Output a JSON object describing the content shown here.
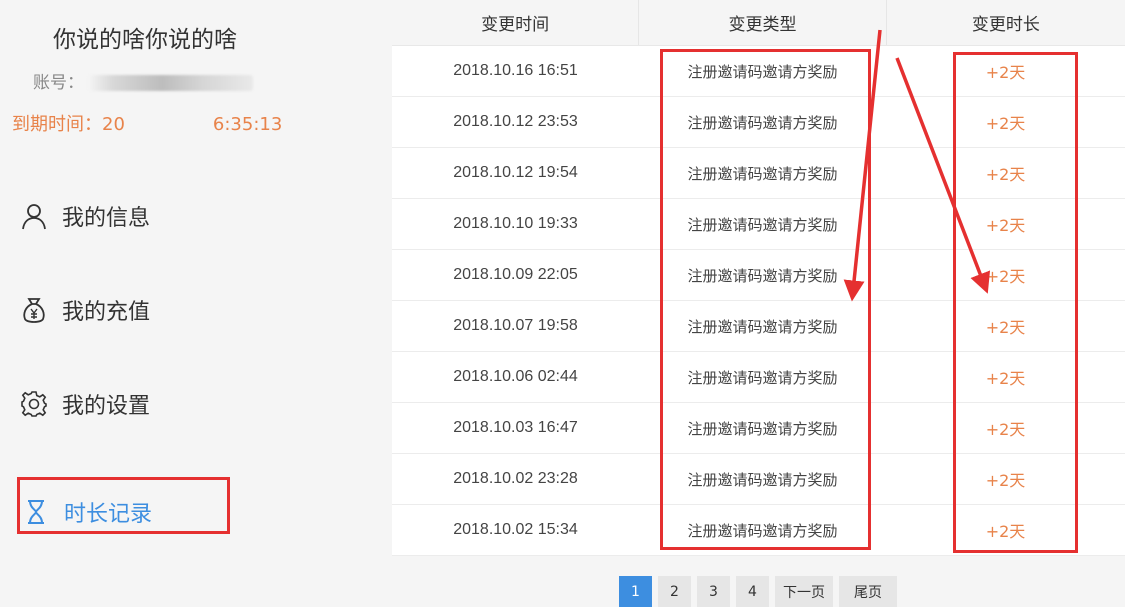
{
  "profile": {
    "username": "你说的啥你说的啥",
    "account_label": "账号：",
    "expire_label": "到期时间：",
    "expire_prefix": "20",
    "expire_suffix": "6:35:13"
  },
  "nav": {
    "items": [
      {
        "label": "我的信息",
        "icon": "user-icon"
      },
      {
        "label": "我的充值",
        "icon": "money-bag-icon"
      },
      {
        "label": "我的设置",
        "icon": "gear-icon"
      },
      {
        "label": "时长记录",
        "icon": "hourglass-icon",
        "active": true
      }
    ]
  },
  "table": {
    "headers": [
      "变更时间",
      "变更类型",
      "变更时长"
    ],
    "rows": [
      {
        "time": "2018.10.16 16:51",
        "type": "注册邀请码邀请方奖励",
        "change": "+2天"
      },
      {
        "time": "2018.10.12 23:53",
        "type": "注册邀请码邀请方奖励",
        "change": "+2天"
      },
      {
        "time": "2018.10.12 19:54",
        "type": "注册邀请码邀请方奖励",
        "change": "+2天"
      },
      {
        "time": "2018.10.10 19:33",
        "type": "注册邀请码邀请方奖励",
        "change": "+2天"
      },
      {
        "time": "2018.10.09 22:05",
        "type": "注册邀请码邀请方奖励",
        "change": "+2天"
      },
      {
        "time": "2018.10.07 19:58",
        "type": "注册邀请码邀请方奖励",
        "change": "+2天"
      },
      {
        "time": "2018.10.06 02:44",
        "type": "注册邀请码邀请方奖励",
        "change": "+2天"
      },
      {
        "time": "2018.10.03 16:47",
        "type": "注册邀请码邀请方奖励",
        "change": "+2天"
      },
      {
        "time": "2018.10.02 23:28",
        "type": "注册邀请码邀请方奖励",
        "change": "+2天"
      },
      {
        "time": "2018.10.02 15:34",
        "type": "注册邀请码邀请方奖励",
        "change": "+2天"
      }
    ]
  },
  "pagination": {
    "pages": [
      "1",
      "2",
      "3",
      "4"
    ],
    "current": "1",
    "next_label": "下一页",
    "last_label": "尾页"
  },
  "colors": {
    "accent": "#3d8ee0",
    "orange": "#e8834a",
    "annotation_red": "#e53030"
  }
}
